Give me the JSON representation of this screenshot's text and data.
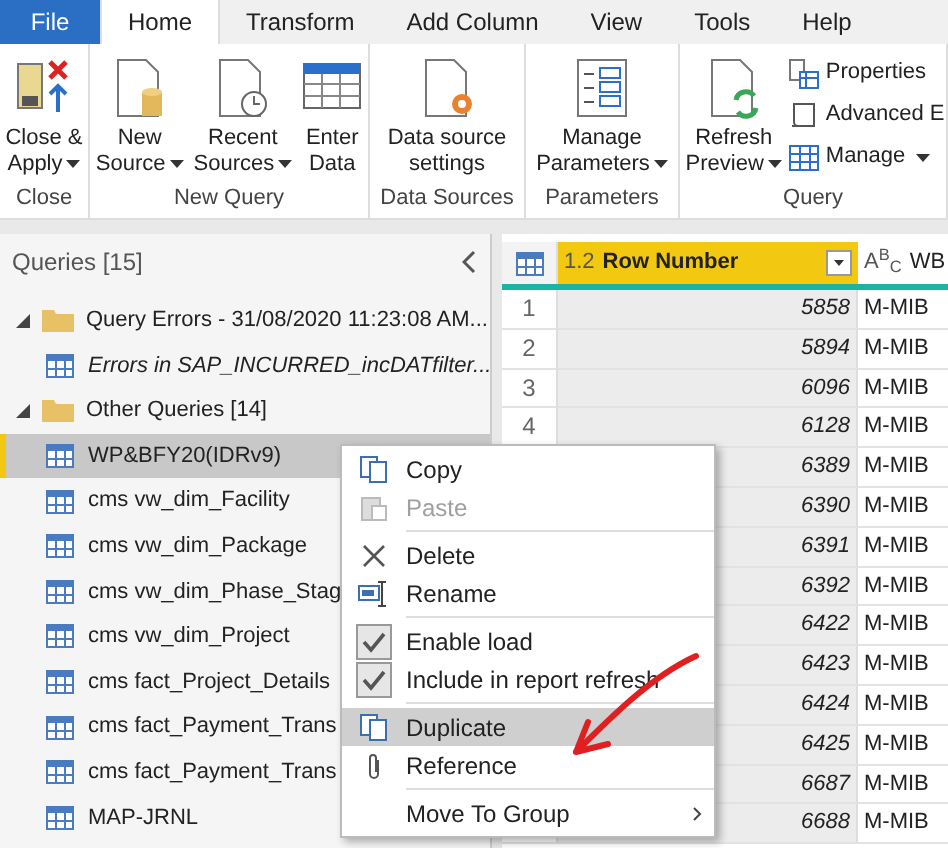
{
  "tabs": [
    {
      "label": "File",
      "kind": "file",
      "selected": false
    },
    {
      "label": "Home",
      "kind": "tab",
      "selected": true
    },
    {
      "label": "Transform",
      "kind": "tab",
      "selected": false
    },
    {
      "label": "Add Column",
      "kind": "tab",
      "selected": false
    },
    {
      "label": "View",
      "kind": "tab",
      "selected": false
    },
    {
      "label": "Tools",
      "kind": "tab",
      "selected": false
    },
    {
      "label": "Help",
      "kind": "tab",
      "selected": false
    }
  ],
  "ribbon": [
    {
      "label": "Close",
      "buttons": [
        {
          "lines": [
            "Close &",
            "Apply"
          ],
          "kind": "large",
          "dropdown": true
        }
      ]
    },
    {
      "label": "New Query",
      "buttons": [
        {
          "lines": [
            "New",
            "Source"
          ],
          "kind": "large",
          "dropdown": true
        },
        {
          "lines": [
            "Recent",
            "Sources"
          ],
          "kind": "large",
          "dropdown": true
        },
        {
          "lines": [
            "Enter",
            "Data"
          ],
          "kind": "large",
          "dropdown": false
        }
      ]
    },
    {
      "label": "Data Sources",
      "buttons": [
        {
          "lines": [
            "Data source",
            "settings"
          ],
          "kind": "large",
          "dropdown": false
        }
      ]
    },
    {
      "label": "Parameters",
      "buttons": [
        {
          "lines": [
            "Manage",
            "Parameters"
          ],
          "kind": "large",
          "dropdown": true
        }
      ]
    },
    {
      "label": "Query",
      "buttons": [
        {
          "lines": [
            "Refresh",
            "Preview"
          ],
          "kind": "large",
          "dropdown": true
        },
        {
          "lines": [
            "Properties"
          ],
          "kind": "small",
          "dropdown": false
        },
        {
          "lines": [
            "Advanced E"
          ],
          "kind": "small",
          "dropdown": false
        },
        {
          "lines": [
            "Manage"
          ],
          "kind": "small",
          "dropdown": true
        }
      ]
    }
  ],
  "queries": {
    "title": "Queries [15]",
    "tree": [
      {
        "label": "Query Errors - 31/08/2020 11:23:08 AM...",
        "kind": "folder",
        "expanded": true,
        "children": [
          {
            "label": "Errors in SAP_INCURRED_incDATfilter...",
            "kind": "error",
            "selected": false
          }
        ]
      },
      {
        "label": "Other Queries [14]",
        "kind": "folder",
        "expanded": true,
        "children": [
          {
            "label": "WP&BFY20(IDRv9)",
            "kind": "query",
            "selected": true
          },
          {
            "label": "cms vw_dim_Facility",
            "kind": "query",
            "selected": false
          },
          {
            "label": "cms vw_dim_Package",
            "kind": "query",
            "selected": false
          },
          {
            "label": "cms vw_dim_Phase_Stag",
            "kind": "query",
            "selected": false
          },
          {
            "label": "cms vw_dim_Project",
            "kind": "query",
            "selected": false
          },
          {
            "label": "cms fact_Project_Details",
            "kind": "query",
            "selected": false
          },
          {
            "label": "cms fact_Payment_Trans",
            "kind": "query",
            "selected": false
          },
          {
            "label": "cms fact_Payment_Trans",
            "kind": "query",
            "selected": false
          },
          {
            "label": "MAP-JRNL",
            "kind": "query",
            "selected": false
          }
        ]
      }
    ]
  },
  "table": {
    "columns": [
      {
        "type_label": "1.2",
        "label": "Row Number",
        "selected": true
      },
      {
        "type_label": "A$^{B}$$_{C}$",
        "label": "WB",
        "selected": false
      }
    ],
    "rows": [
      {
        "number": "1",
        "cells": [
          "5858",
          "M-MIB"
        ]
      },
      {
        "number": "2",
        "cells": [
          "5894",
          "M-MIB"
        ]
      },
      {
        "number": "3",
        "cells": [
          "6096",
          "M-MIB"
        ]
      },
      {
        "number": "4",
        "cells": [
          "6128",
          "M-MIB"
        ]
      },
      {
        "cells": [
          "6389",
          "M-MIB"
        ]
      },
      {
        "cells": [
          "6390",
          "M-MIB"
        ]
      },
      {
        "cells": [
          "6391",
          "M-MIB"
        ]
      },
      {
        "cells": [
          "6392",
          "M-MIB"
        ]
      },
      {
        "cells": [
          "6422",
          "M-MIB"
        ]
      },
      {
        "cells": [
          "6423",
          "M-MIB"
        ]
      },
      {
        "cells": [
          "6424",
          "M-MIB"
        ]
      },
      {
        "cells": [
          "6425",
          "M-MIB"
        ]
      },
      {
        "cells": [
          "6687",
          "M-MIB"
        ]
      },
      {
        "cells": [
          "6688",
          "M-MIB"
        ]
      }
    ]
  },
  "context_menu": [
    {
      "kind": "item",
      "label": "Copy",
      "disabled": false,
      "selected": false
    },
    {
      "kind": "item",
      "label": "Paste",
      "disabled": true,
      "selected": false
    },
    {
      "kind": "separator"
    },
    {
      "kind": "item",
      "label": "Delete",
      "disabled": false,
      "selected": false
    },
    {
      "kind": "item",
      "label": "Rename",
      "disabled": false,
      "selected": false
    },
    {
      "kind": "separator"
    },
    {
      "kind": "check",
      "label": "Enable load",
      "checked": true,
      "selected": false
    },
    {
      "kind": "check",
      "label": "Include in report refresh",
      "checked": true,
      "selected": false
    },
    {
      "kind": "separator"
    },
    {
      "kind": "item",
      "label": "Duplicate",
      "disabled": false,
      "selected": true
    },
    {
      "kind": "item",
      "label": "Reference",
      "disabled": false,
      "selected": false
    },
    {
      "kind": "separator"
    },
    {
      "kind": "submenu",
      "label": "Move To Group",
      "disabled": false,
      "selected": false
    }
  ]
}
